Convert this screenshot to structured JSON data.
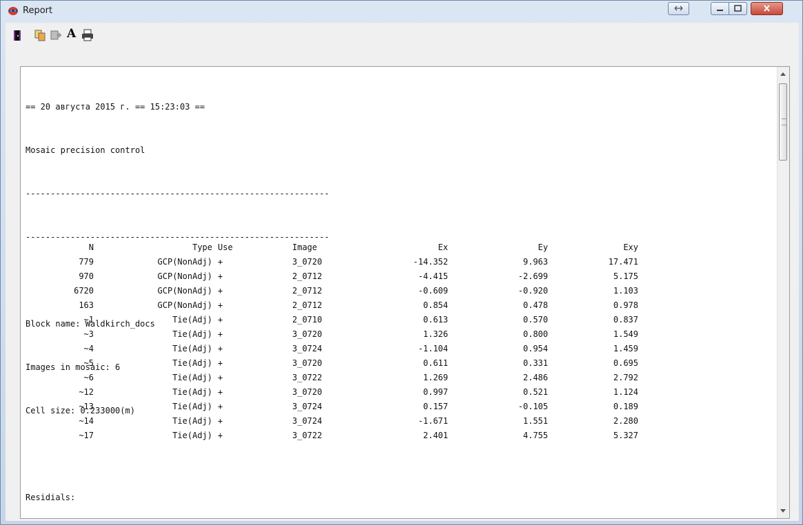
{
  "window": {
    "title": "Report"
  },
  "toolbar": {
    "icons": [
      "exit-icon",
      "copy-icon",
      "paste-icon",
      "font-icon",
      "print-icon"
    ],
    "font_label": "A"
  },
  "report": {
    "lines": [
      "== 20 августа 2015 г. == 15:23:03 ==",
      "Mosaic precision control",
      "-------------------------------------------------------------",
      "-------------------------------------------------------------",
      "",
      "Block name: Waldkirch_docs",
      "Images in mosaic: 6",
      "Cell size: 0.233000(m)",
      "",
      "Residials:"
    ],
    "table": {
      "columns": [
        "N",
        "Type",
        "Use",
        "Image",
        "Ex",
        "Ey",
        "Exy"
      ],
      "rows": [
        [
          "779",
          "GCP(NonAdj)",
          "+",
          "3_0720",
          "-14.352",
          "9.963",
          "17.471"
        ],
        [
          "970",
          "GCP(NonAdj)",
          "+",
          "2_0712",
          "-4.415",
          "-2.699",
          "5.175"
        ],
        [
          "6720",
          "GCP(NonAdj)",
          "+",
          "2_0712",
          "-0.609",
          "-0.920",
          "1.103"
        ],
        [
          "163",
          "GCP(NonAdj)",
          "+",
          "2_0712",
          "0.854",
          "0.478",
          "0.978"
        ],
        [
          "~1",
          "Tie(Adj)",
          "+",
          "2_0710",
          "0.613",
          "0.570",
          "0.837"
        ],
        [
          "~3",
          "Tie(Adj)",
          "+",
          "3_0720",
          "1.326",
          "0.800",
          "1.549"
        ],
        [
          "~4",
          "Tie(Adj)",
          "+",
          "3_0724",
          "-1.104",
          "0.954",
          "1.459"
        ],
        [
          "~5",
          "Tie(Adj)",
          "+",
          "3_0720",
          "0.611",
          "0.331",
          "0.695"
        ],
        [
          "~6",
          "Tie(Adj)",
          "+",
          "3_0722",
          "1.269",
          "2.486",
          "2.792"
        ],
        [
          "~12",
          "Tie(Adj)",
          "+",
          "3_0720",
          "0.997",
          "0.521",
          "1.124"
        ],
        [
          "~13",
          "Tie(Adj)",
          "+",
          "3_0724",
          "0.157",
          "-0.105",
          "0.189"
        ],
        [
          "~14",
          "Tie(Adj)",
          "+",
          "3_0724",
          "-1.671",
          "1.551",
          "2.280"
        ],
        [
          "~17",
          "Tie(Adj)",
          "+",
          "3_0722",
          "2.401",
          "4.755",
          "5.327"
        ]
      ]
    }
  }
}
